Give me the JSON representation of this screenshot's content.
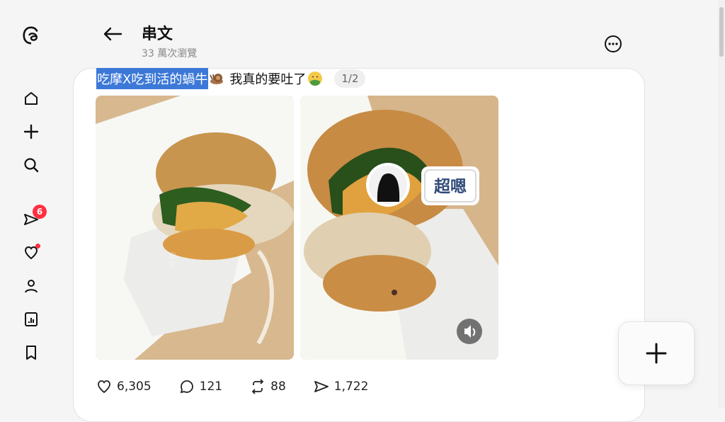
{
  "header": {
    "title": "串文",
    "views": "33 萬次瀏覽"
  },
  "sidebar": {
    "items": [
      {
        "name": "home"
      },
      {
        "name": "create"
      },
      {
        "name": "search"
      },
      {
        "name": "messages",
        "badge": "6"
      },
      {
        "name": "activity"
      },
      {
        "name": "profile"
      },
      {
        "name": "insights"
      },
      {
        "name": "saved"
      }
    ]
  },
  "post": {
    "highlighted_text": "吃摩X吃到活的蝸牛",
    "text": "我真的要吐了",
    "page_indicator": "1/2",
    "images": [
      {
        "overlay_text": ""
      },
      {
        "overlay_label": "超嗯"
      }
    ]
  },
  "stats": {
    "likes": "6,305",
    "comments": "121",
    "reposts": "88",
    "shares": "1,722"
  },
  "colors": {
    "highlight": "#3c78d8",
    "badge": "#ff3040"
  }
}
